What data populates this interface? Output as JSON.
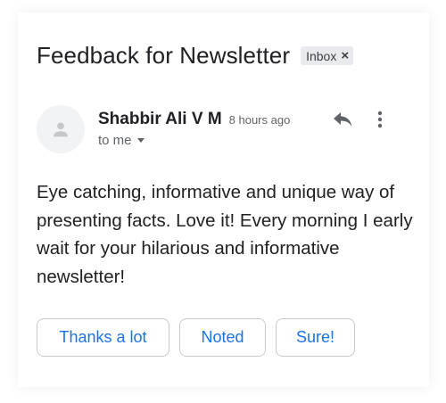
{
  "email": {
    "subject": "Feedback for Newsletter",
    "label": "Inbox",
    "label_close_glyph": "×",
    "sender_name": "Shabbir Ali V M",
    "time": "8 hours ago",
    "recipient": "to me",
    "body": "Eye catching, informative and unique way of presenting facts. Love it! Every morning I early wait for your hilarious and informative newsletter!"
  },
  "smart_replies": {
    "reply_1": "Thanks a lot",
    "reply_2": "Noted",
    "reply_3": "Sure!"
  },
  "icons": {
    "avatar": "person-icon",
    "reply": "reply-icon",
    "more": "more-vert-icon",
    "recipient_details": "caret-down-icon"
  },
  "colors": {
    "text": "#202124",
    "muted": "#5f6368",
    "chip_bg": "#e8eaed",
    "avatar_bg": "#f1f3f4",
    "link_blue": "#1a73e8",
    "border": "#c8cacd"
  }
}
